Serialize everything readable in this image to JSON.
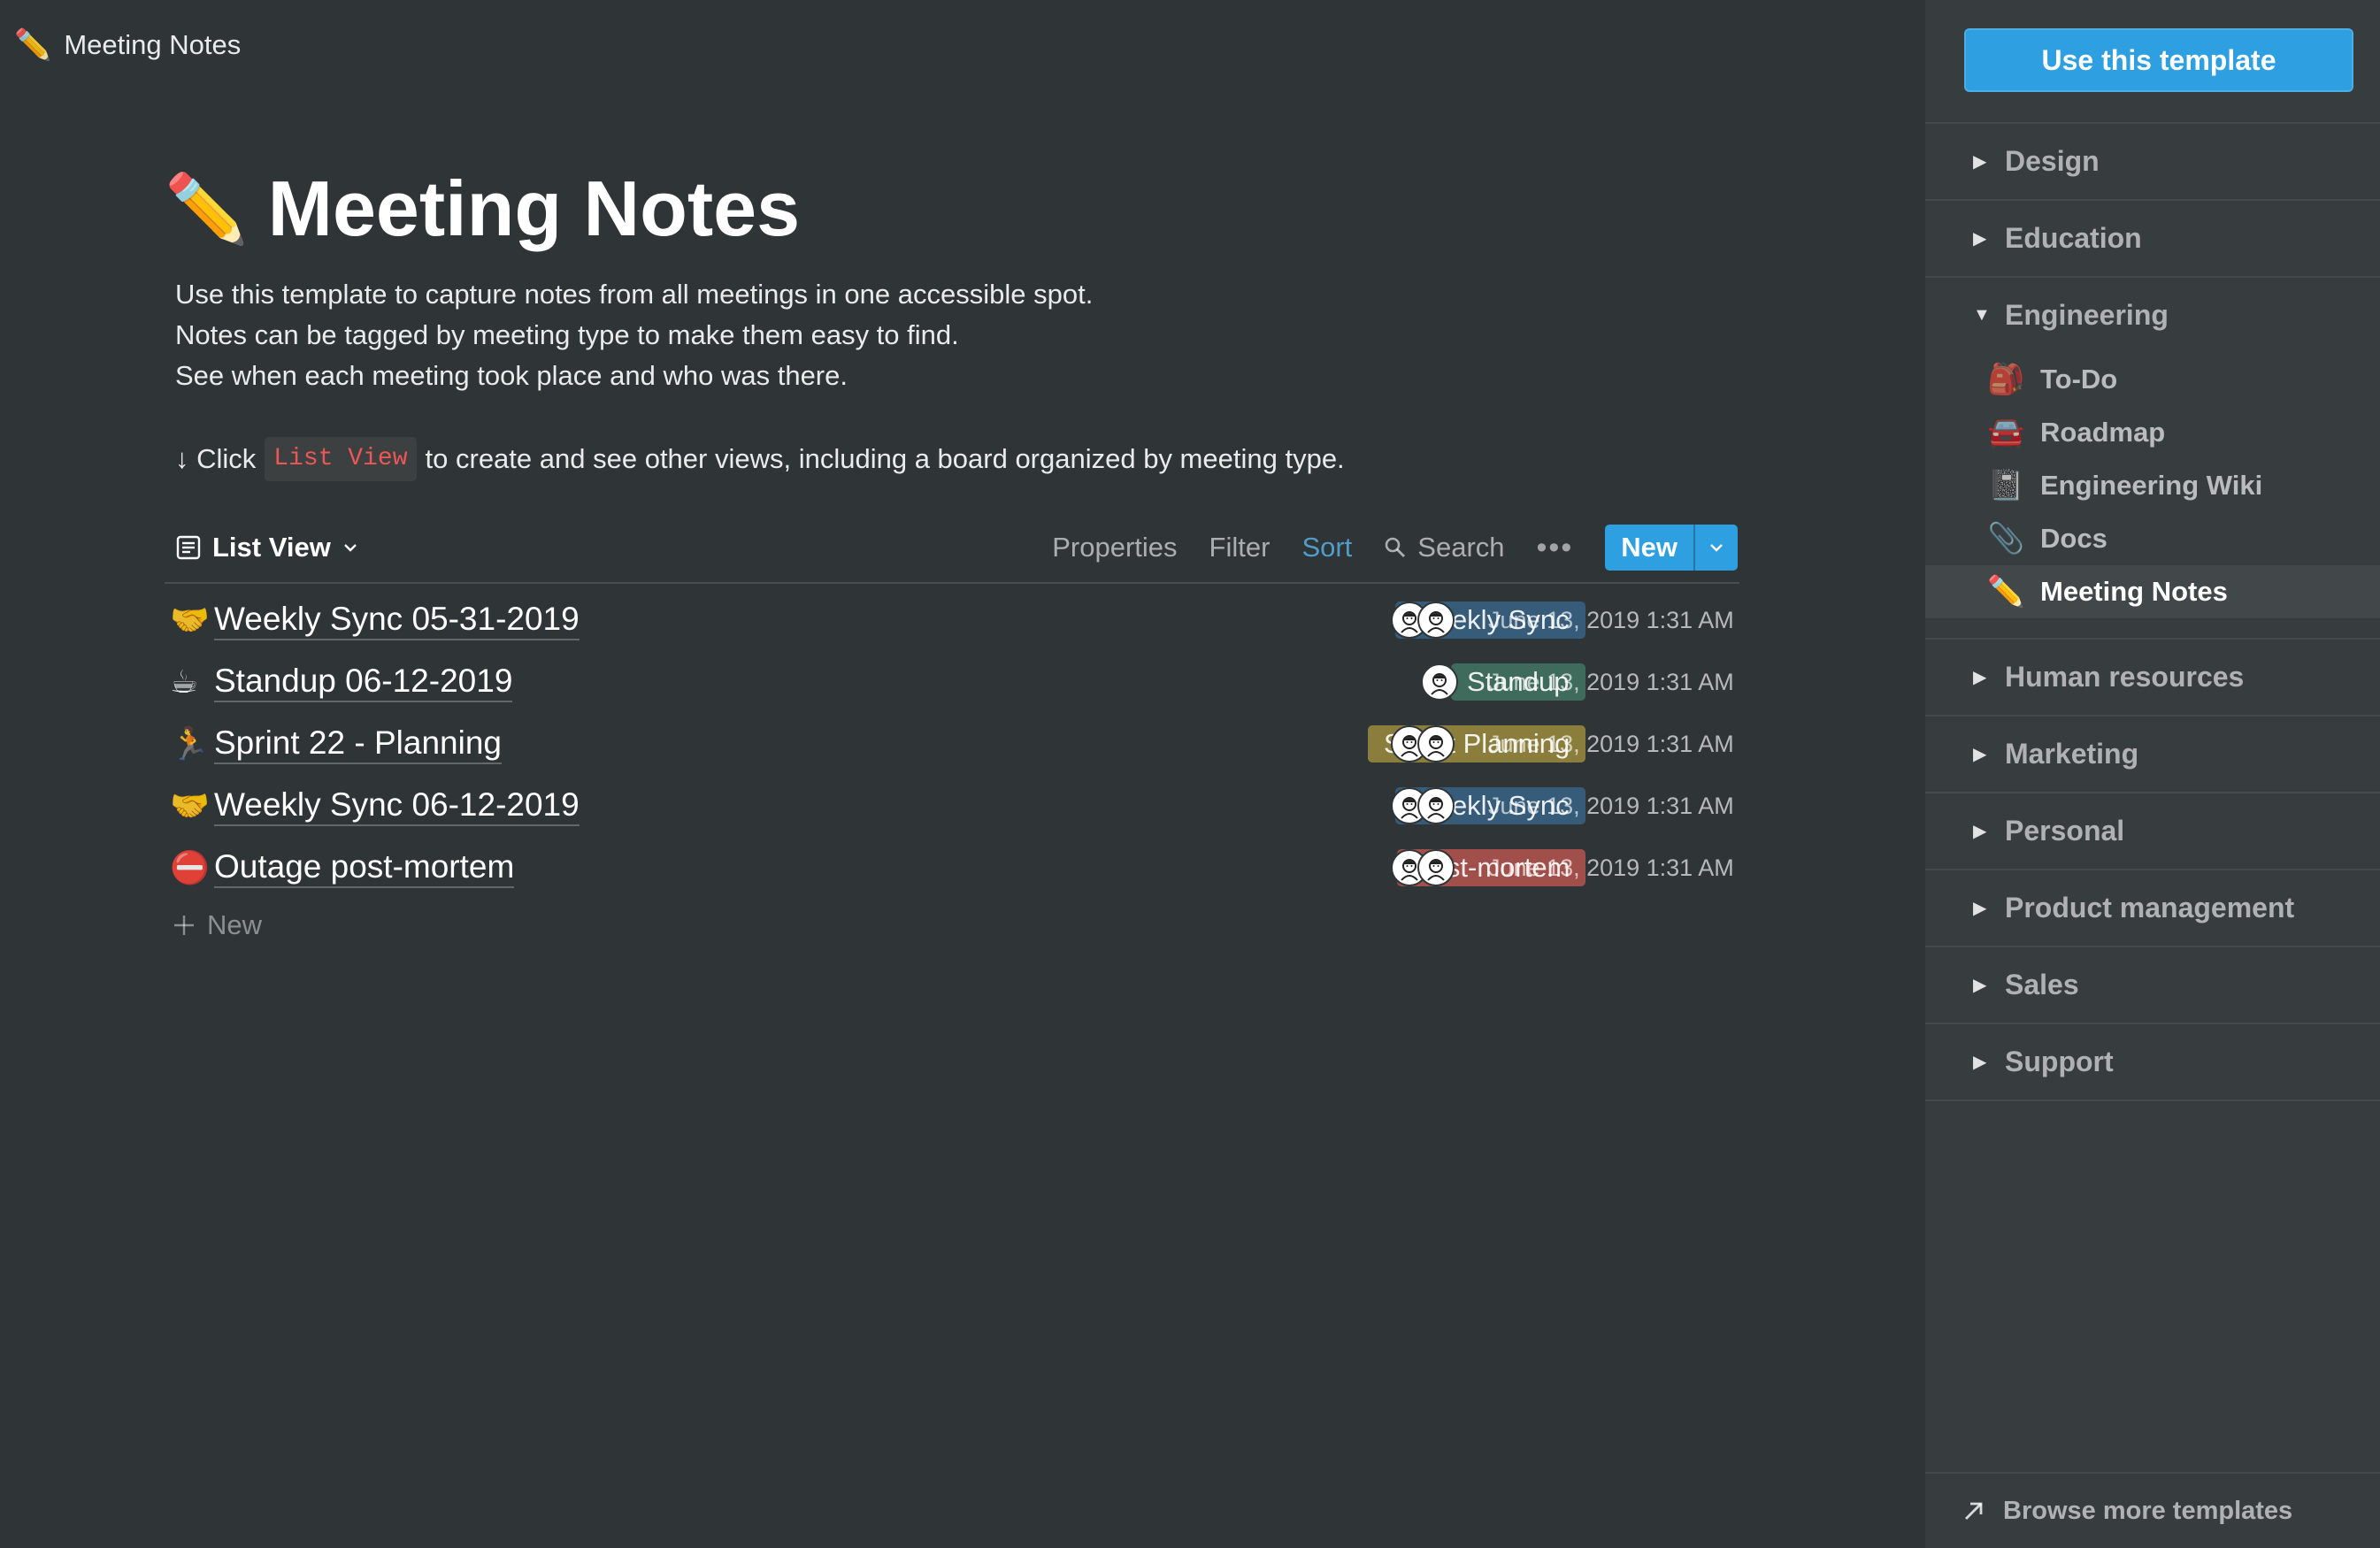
{
  "topbar": {
    "icon": "pencil-emoji",
    "emoji": "✏️",
    "title": "Meeting Notes"
  },
  "page": {
    "emoji": "✏️",
    "title": "Meeting Notes",
    "desc_lines": [
      "Use this template to capture notes from all meetings in one accessible spot.",
      "Notes can be tagged by meeting type to make them easy to find.",
      "See when each meeting took place and who was there."
    ],
    "hint": {
      "arrow": "↓",
      "click": "Click",
      "code": "List View",
      "rest": "to create and see other views, including a board organized by meeting type."
    }
  },
  "toolbar": {
    "view_label": "List View",
    "properties": "Properties",
    "filter": "Filter",
    "sort": "Sort",
    "search": "Search",
    "more": "•••",
    "new": "New"
  },
  "rows": [
    {
      "emoji": "🤝",
      "name": "Weekly Sync 05-31-2019",
      "tag": "Weekly Sync",
      "tag_color": "#365c7a",
      "people": 2,
      "date": "June 13, 2019 1:31 AM"
    },
    {
      "emoji": "☕",
      "name": "Standup 06-12-2019",
      "tag": "Standup",
      "tag_color": "#3f6b5c",
      "people": 1,
      "date": "June 13, 2019 1:31 AM"
    },
    {
      "emoji": "🏃",
      "name": "Sprint 22 - Planning",
      "tag": "Sprint Planning",
      "tag_color": "#8b7e3c",
      "people": 2,
      "date": "June 13, 2019 1:31 AM"
    },
    {
      "emoji": "🤝",
      "name": "Weekly Sync 06-12-2019",
      "tag": "Weekly Sync",
      "tag_color": "#365c7a",
      "people": 2,
      "date": "June 13, 2019 1:31 AM"
    },
    {
      "emoji": "⛔",
      "name": "Outage post-mortem",
      "tag": "Post-mortem",
      "tag_color": "#a04f4b",
      "people": 2,
      "date": "June 13, 2019 1:31 AM"
    }
  ],
  "new_row": "New",
  "sidebar": {
    "use_template": "Use this template",
    "categories_top": [
      "Design",
      "Education"
    ],
    "engineering": {
      "label": "Engineering",
      "items": [
        {
          "emoji": "🎒",
          "label": "To-Do"
        },
        {
          "emoji": "🚘",
          "label": "Roadmap"
        },
        {
          "emoji": "📓",
          "label": "Engineering Wiki"
        },
        {
          "emoji": "📎",
          "label": "Docs"
        },
        {
          "emoji": "✏️",
          "label": "Meeting Notes"
        }
      ]
    },
    "categories_bottom": [
      "Human resources",
      "Marketing",
      "Personal",
      "Product management",
      "Sales",
      "Support"
    ],
    "browse": "Browse more templates"
  }
}
